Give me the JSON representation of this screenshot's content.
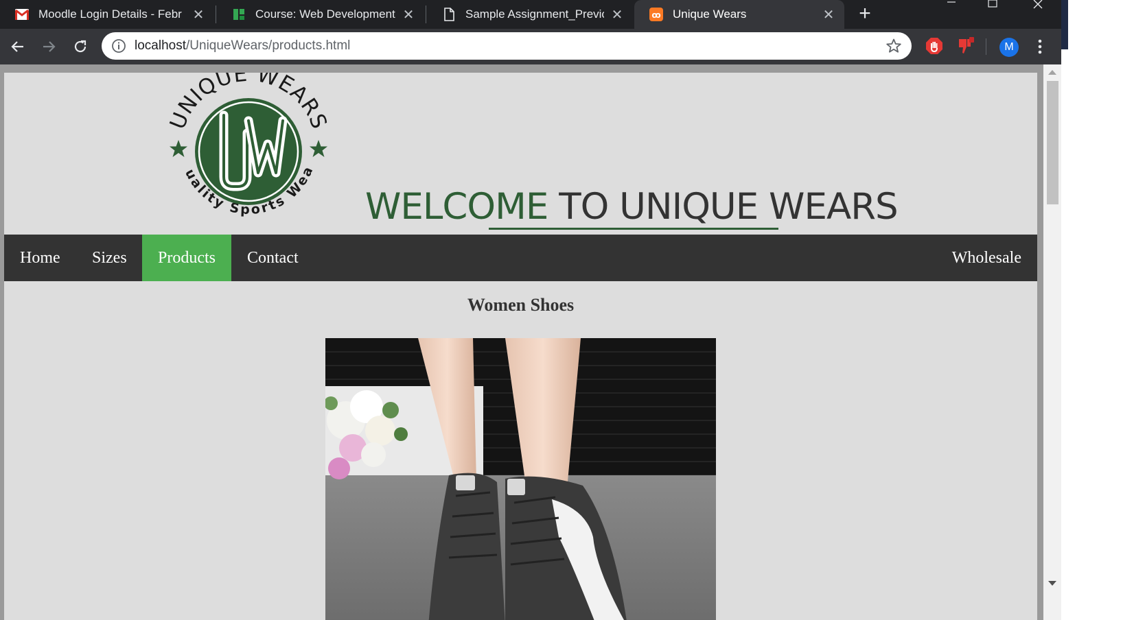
{
  "browser": {
    "tabs": [
      {
        "title": "Moodle Login Details - Febr",
        "icon": "gmail-icon",
        "active": false
      },
      {
        "title": "Course: Web Development -",
        "icon": "moodle-icon",
        "active": false
      },
      {
        "title": "Sample Assignment_Previou",
        "icon": "document-icon",
        "active": false
      },
      {
        "title": "Unique Wears",
        "icon": "xampp-icon",
        "active": true
      }
    ],
    "new_tab": "+",
    "close_glyph": "✕",
    "url_host": "localhost",
    "url_path": "/UniqueWears/products.html",
    "avatar_letter": "M",
    "accent": "#1a73e8"
  },
  "site": {
    "logo": {
      "arc_top": "UNIQUE WEARS",
      "arc_bottom": "Quality Sports Wear",
      "monogram": "UW",
      "color": "#2e5e35"
    },
    "welcome_highlight": "WELCOME",
    "welcome_rest": " TO UNIQUE WEARS",
    "nav": [
      {
        "label": "Home",
        "active": false
      },
      {
        "label": "Sizes",
        "active": false
      },
      {
        "label": "Products",
        "active": true
      },
      {
        "label": "Contact",
        "active": false
      },
      {
        "label": "Wholesale",
        "active": false
      }
    ],
    "nav_active_color": "#4caf50",
    "section_title": "Women Shoes",
    "product_image_alt": "product-photo-shoes"
  }
}
